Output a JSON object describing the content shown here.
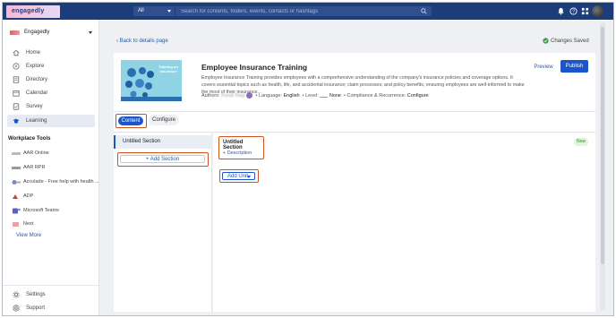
{
  "header": {
    "logo_text": "engagedly",
    "search_scope": "All",
    "search_placeholder": "Search for contents, folders, events, contacts or hashtags",
    "icons": [
      "bell-icon",
      "help-icon",
      "grid-icon",
      "avatar"
    ]
  },
  "sidebar": {
    "org_name": "Engagedly",
    "items": [
      {
        "label": "Home",
        "icon": "home-icon"
      },
      {
        "label": "Explore",
        "icon": "explore-icon"
      },
      {
        "label": "Directory",
        "icon": "directory-icon"
      },
      {
        "label": "Calendar",
        "icon": "calendar-icon"
      },
      {
        "label": "Survey",
        "icon": "survey-icon"
      },
      {
        "label": "Learning",
        "icon": "learning-icon",
        "active": true
      }
    ],
    "tools_heading": "Workplace Tools",
    "tools": [
      {
        "label": "AAR Online"
      },
      {
        "label": "AAR RPR"
      },
      {
        "label": "Accolade - Free help with health ..."
      },
      {
        "label": "ADP"
      },
      {
        "label": "Microsoft Teams"
      },
      {
        "label": "Next"
      }
    ],
    "view_more": "View More",
    "bottom": [
      {
        "label": "Settings",
        "icon": "gear-icon"
      },
      {
        "label": "Support",
        "icon": "support-icon"
      }
    ]
  },
  "page": {
    "back_link": "Back to details page",
    "status": "Changes Saved"
  },
  "course": {
    "title": "Employee Insurance Training",
    "thumbnail_text": "Training on Insurance",
    "description": "Employee Insurance Training provides employees with a comprehensive understanding of the company's insurance policies and coverage options. It covers essential topics such as health, life, and accidental insurance; claim processes; and policy benefits, ensuring employees are well-informed to make the most of their insurance...",
    "authors_label": "Authors:",
    "author_name": "Ranjit Nagi",
    "language_label": "Language:",
    "language": "English",
    "level_label": "Level:",
    "level": "None",
    "compliance_label": "Compliance & Recurrence:",
    "compliance": "Configure",
    "preview_label": "Preview",
    "publish_label": "Publish"
  },
  "tabs": [
    {
      "label": "Content",
      "active": true
    },
    {
      "label": "Configure",
      "active": false
    }
  ],
  "sections": {
    "items": [
      {
        "label": "Untitled Section"
      }
    ],
    "add_label": "+ Add Section"
  },
  "editor": {
    "section_title": "Untitled Section",
    "description_link": "+ Description",
    "badge": "New",
    "add_unit_label": "Add Unit"
  },
  "colors": {
    "topbar": "#1d3d7a",
    "primary": "#1a56c9",
    "highlight": "#d0521f",
    "badge_bg": "#e3f4dd",
    "badge_fg": "#3d8b2f"
  }
}
